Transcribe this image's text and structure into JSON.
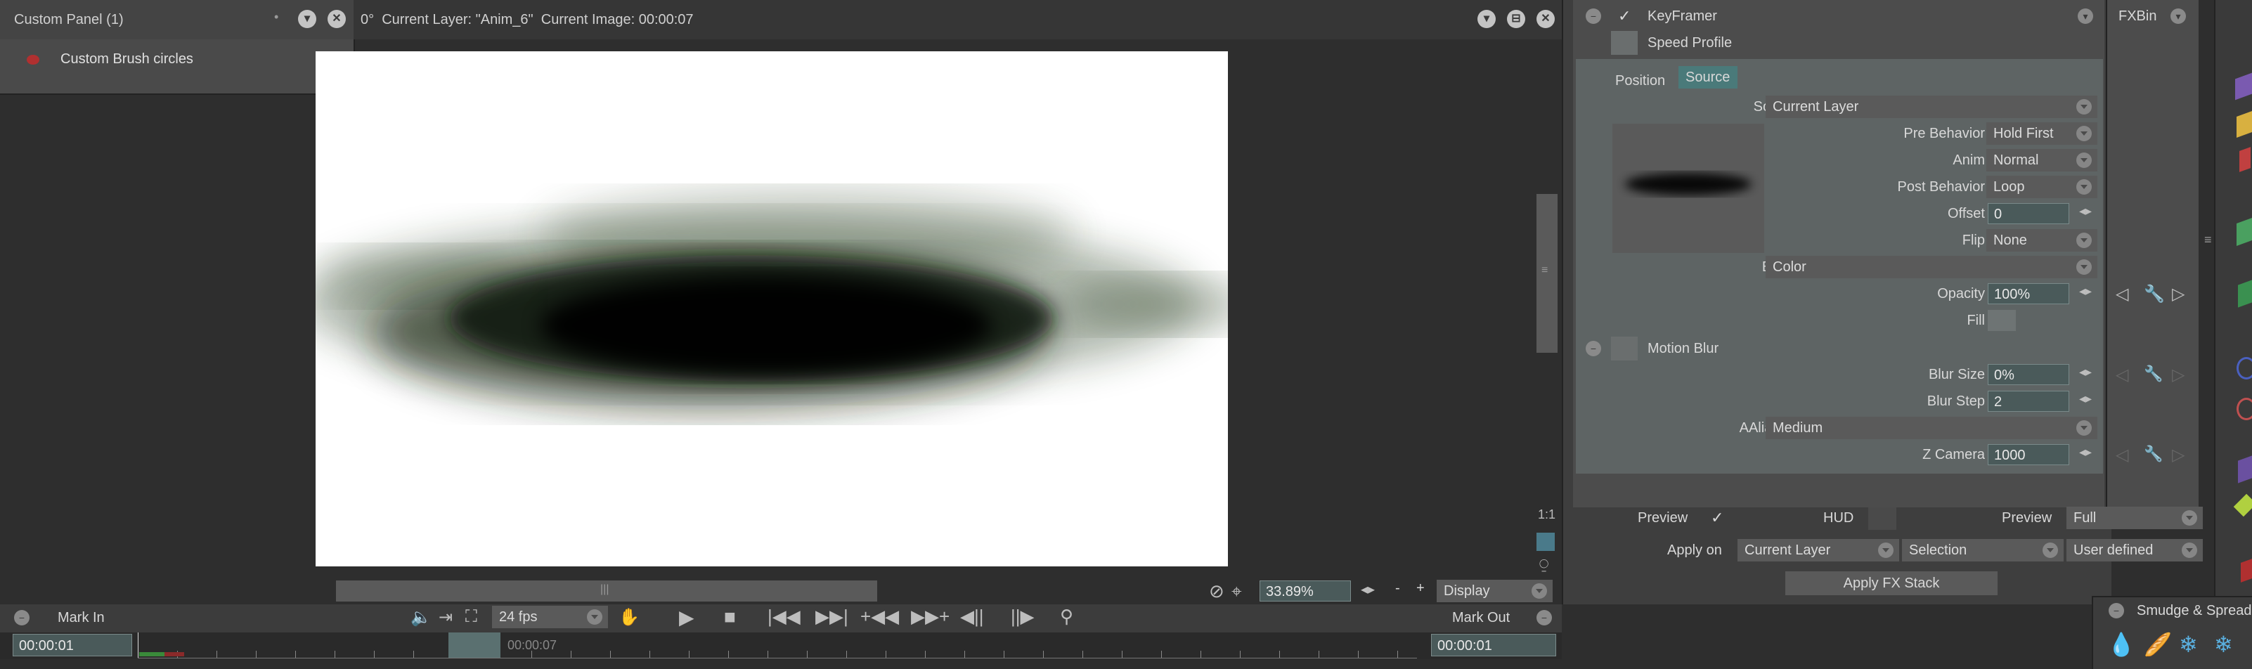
{
  "custom_panel": {
    "title": "Custom Panel (1)",
    "item": "Custom Brush circles"
  },
  "viewport": {
    "header": "0°  Current Layer: \"Anim_6\"  Current Image: 00:00:07",
    "zoom": "33.89%",
    "display_label": "Display",
    "zoom_minus": "-",
    "zoom_plus": "+"
  },
  "timeline": {
    "mark_in": "Mark In",
    "mark_out": "Mark Out",
    "fps": "24 fps",
    "time_start": "00:00:01",
    "time_current": "00:00:07",
    "time_end": "00:00:01"
  },
  "fx": {
    "keyframer_label": "KeyFramer",
    "speed_profile": "Speed Profile",
    "tabs": [
      "Position",
      "Source"
    ],
    "fxbin_label": "FXBin",
    "source_label": "Source",
    "source_value": "Current Layer",
    "pre_behavior_label": "Pre Behavior",
    "pre_behavior_value": "Hold First",
    "anim_label": "Anim",
    "anim_value": "Normal",
    "post_behavior_label": "Post Behavior",
    "post_behavior_value": "Loop",
    "offset_label": "Offset",
    "offset_value": "0",
    "flip_label": "Flip",
    "flip_value": "None",
    "blend_label": "Blend",
    "blend_value": "Color",
    "opacity_label": "Opacity",
    "opacity_value": "100%",
    "fill_label": "Fill",
    "motion_blur_label": "Motion Blur",
    "blur_size_label": "Blur Size",
    "blur_size_value": "0%",
    "blur_step_label": "Blur Step",
    "blur_step_value": "2",
    "aaliasing_label": "AAliasing",
    "aaliasing_value": "Medium",
    "z_camera_label": "Z Camera",
    "z_camera_value": "1000",
    "preview_label": "Preview",
    "hud_label": "HUD",
    "preview2_label": "Preview",
    "preview2_value": "Full",
    "apply_on_label": "Apply on",
    "apply_on_value": "Current Layer",
    "selection_value": "Selection",
    "user_defined_value": "User defined",
    "apply_button": "Apply FX Stack"
  },
  "brush_panel": {
    "title": "Smudge & Spread"
  },
  "colors": {
    "background": "#2e2e2e",
    "panel": "#474747",
    "fx_panel": "#5d6363",
    "canvas": "#ffffff",
    "paint": "#0f1f0c",
    "tab_active": "#4a7a7a"
  }
}
